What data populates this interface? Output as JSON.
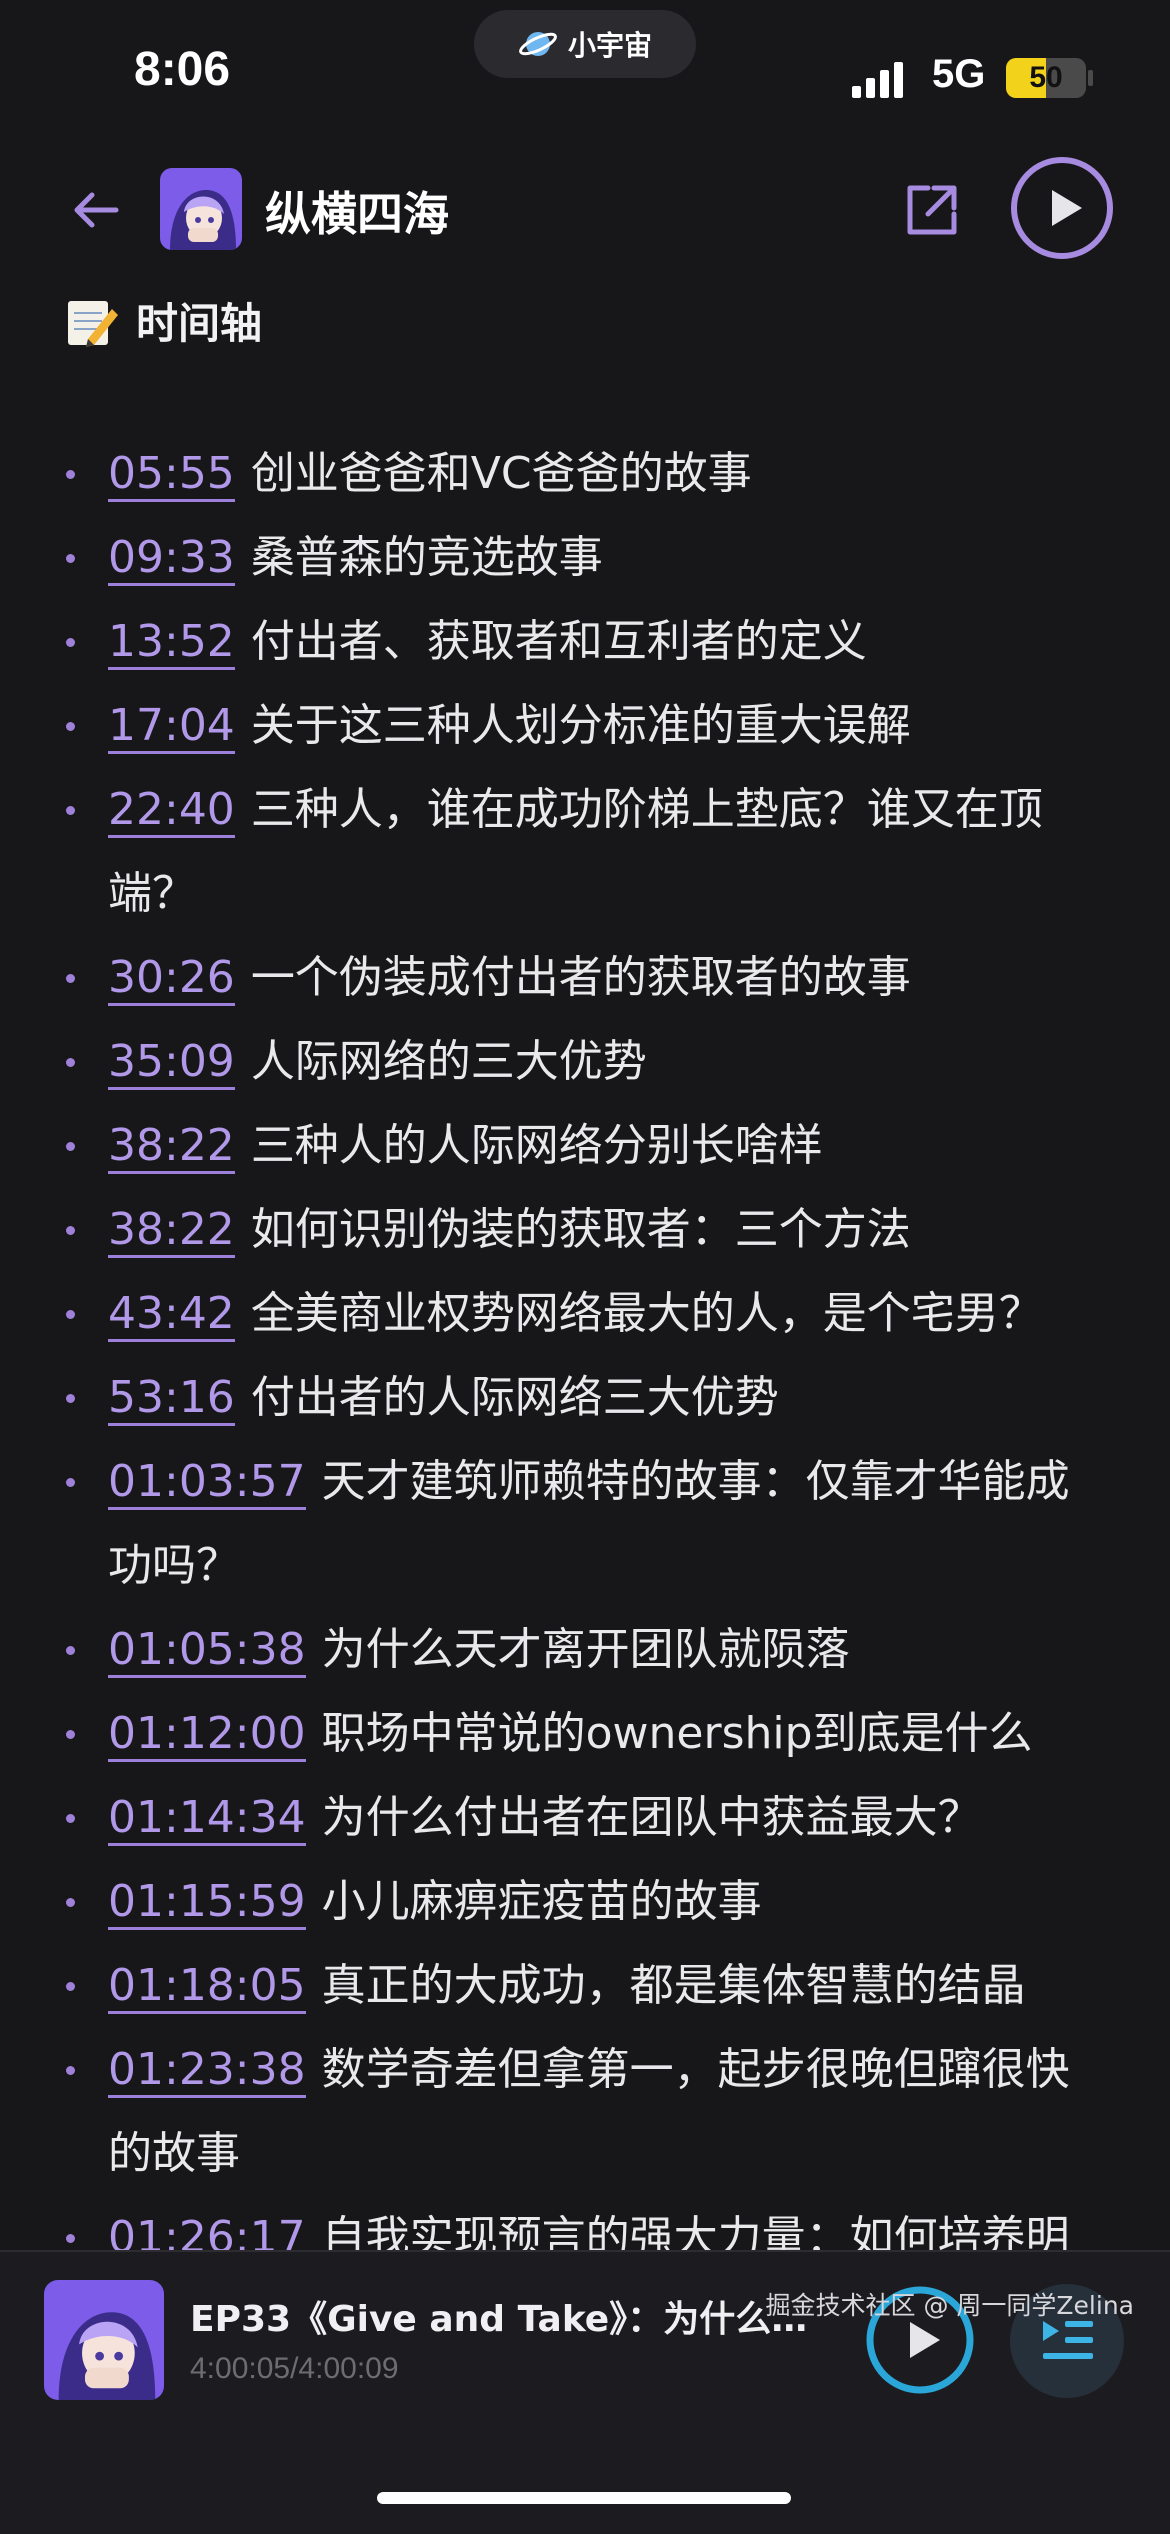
{
  "status": {
    "time": "8:06",
    "app_pill": "小宇宙",
    "network": "5G",
    "battery": "50",
    "battery_level": 0.5
  },
  "header": {
    "title": "纵横四海",
    "cover_text": "纵横四海"
  },
  "section": {
    "title": "时间轴"
  },
  "timeline": [
    {
      "time": "05:55",
      "text": "创业爸爸和VC爸爸的故事"
    },
    {
      "time": "09:33",
      "text": "桑普森的竞选故事"
    },
    {
      "time": "13:52",
      "text": "付出者、获取者和互利者的定义"
    },
    {
      "time": "17:04",
      "text": "关于这三种人划分标准的重大误解"
    },
    {
      "time": "22:40",
      "text": "三种人，谁在成功阶梯上垫底？谁又在顶端？"
    },
    {
      "time": "30:26",
      "text": "一个伪装成付出者的获取者的故事"
    },
    {
      "time": "35:09",
      "text": "人际网络的三大优势"
    },
    {
      "time": "38:22",
      "text": "三种人的人际网络分别长啥样"
    },
    {
      "time": "38:22",
      "text": "如何识别伪装的获取者：三个方法"
    },
    {
      "time": "43:42",
      "text": "全美商业权势网络最大的人，是个宅男？"
    },
    {
      "time": "53:16",
      "text": "付出者的人际网络三大优势"
    },
    {
      "time": "01:03:57",
      "text": "天才建筑师赖特的故事：仅靠才华能成功吗？"
    },
    {
      "time": "01:05:38",
      "text": "为什么天才离开团队就陨落"
    },
    {
      "time": "01:12:00",
      "text": "职场中常说的ownership到底是什么"
    },
    {
      "time": "01:14:34",
      "text": "为什么付出者在团队中获益最大？"
    },
    {
      "time": "01:15:59",
      "text": "小儿麻痹症疫苗的故事"
    },
    {
      "time": "01:18:05",
      "text": "真正的大成功，都是集体智慧的结晶"
    },
    {
      "time": "01:23:38",
      "text": "数学奇差但拿第一，起步很晚但蹿很快的故事"
    },
    {
      "time": "01:26:17",
      "text": "自我实现预言的强大力量：如何培养明"
    }
  ],
  "player": {
    "episode_title": "EP33《Give and Take》：为什么付…",
    "progress_text": "4:00:05/4:00:09",
    "cover_text": "纵横四海"
  },
  "watermark": "掘金技术社区 @ 周一同学Zelina",
  "colors": {
    "accent": "#a78be0",
    "background": "#17171a",
    "play_ring": "#2aa6d9"
  }
}
